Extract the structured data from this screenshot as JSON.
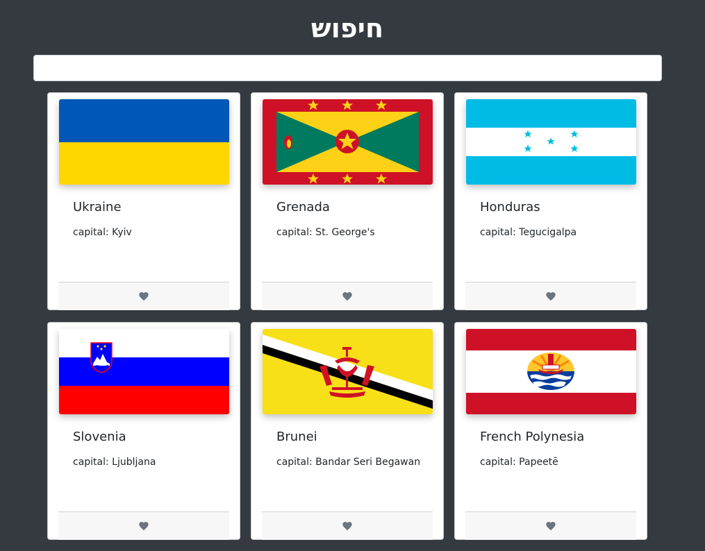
{
  "header": {
    "title": "חיפוש"
  },
  "search": {
    "value": "",
    "placeholder": ""
  },
  "colors": {
    "background": "#343a40",
    "heart": "#6c757d"
  },
  "cards": [
    {
      "name": "Ukraine",
      "capital": "capital: Kyiv",
      "flag": "ukraine-flag"
    },
    {
      "name": "Grenada",
      "capital": "capital: St. George's",
      "flag": "grenada-flag"
    },
    {
      "name": "Honduras",
      "capital": "capital: Tegucigalpa",
      "flag": "honduras-flag"
    },
    {
      "name": "Slovenia",
      "capital": "capital: Ljubljana",
      "flag": "slovenia-flag"
    },
    {
      "name": "Brunei",
      "capital": "capital: Bandar Seri Begawan",
      "flag": "brunei-flag"
    },
    {
      "name": "French Polynesia",
      "capital": "capital: Papeetē",
      "flag": "french-polynesia-flag"
    }
  ],
  "favorite_icon": "heart-icon"
}
